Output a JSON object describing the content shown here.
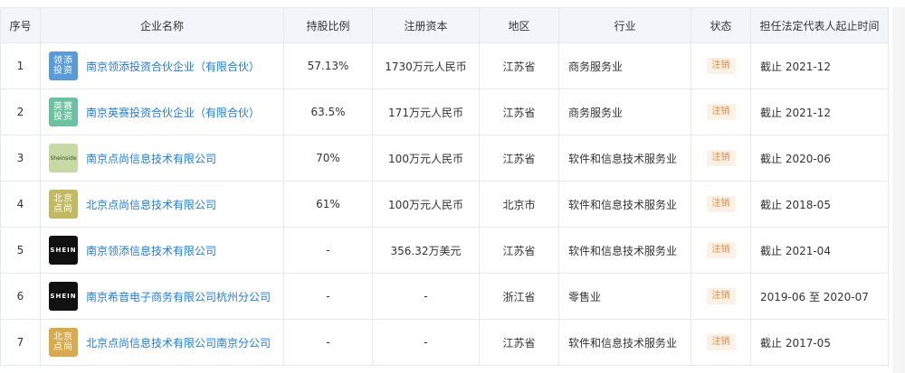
{
  "headers": {
    "index": "序号",
    "company": "企业名称",
    "ratio": "持股比例",
    "capital": "注册资本",
    "region": "地区",
    "industry": "行业",
    "status": "状态",
    "tenure": "担任法定代表人起止时间"
  },
  "rows": [
    {
      "index": "1",
      "logo_text": "领添投资",
      "logo_color": "#5b9bd5",
      "logo_style": "light",
      "company": "南京领添投资合伙企业（有限合伙）",
      "ratio": "57.13%",
      "capital": "1730万元人民币",
      "region": "江苏省",
      "industry": "商务服务业",
      "status": "注销",
      "tenure": "截止 2021-12"
    },
    {
      "index": "2",
      "logo_text": "英赛投资",
      "logo_color": "#6cc1a1",
      "logo_style": "light",
      "company": "南京英赛投资合伙企业（有限合伙）",
      "ratio": "63.5%",
      "capital": "171万元人民币",
      "region": "江苏省",
      "industry": "商务服务业",
      "status": "注销",
      "tenure": "截止 2021-12"
    },
    {
      "index": "3",
      "logo_text": "Sheinside",
      "logo_color": "#c7d9a5",
      "logo_style": "sheinside",
      "company": "南京点尚信息技术有限公司",
      "ratio": "70%",
      "capital": "100万元人民币",
      "region": "江苏省",
      "industry": "软件和信息技术服务业",
      "status": "注销",
      "tenure": "截止 2020-06"
    },
    {
      "index": "4",
      "logo_text": "北京点尚",
      "logo_color": "#c2b963",
      "logo_style": "light",
      "company": "北京点尚信息技术有限公司",
      "ratio": "61%",
      "capital": "100万元人民币",
      "region": "北京市",
      "industry": "软件和信息技术服务业",
      "status": "注销",
      "tenure": "截止 2018-05"
    },
    {
      "index": "5",
      "logo_text": "SHEIN",
      "logo_color": "#111111",
      "logo_style": "dark",
      "company": "南京领添信息技术有限公司",
      "ratio": "-",
      "capital": "356.32万美元",
      "region": "江苏省",
      "industry": "软件和信息技术服务业",
      "status": "注销",
      "tenure": "截止 2021-04"
    },
    {
      "index": "6",
      "logo_text": "SHEIN",
      "logo_color": "#111111",
      "logo_style": "dark",
      "company": "南京希音电子商务有限公司杭州分公司",
      "ratio": "-",
      "capital": "-",
      "region": "浙江省",
      "industry": "零售业",
      "status": "注销",
      "tenure": "2019-06 至 2020-07"
    },
    {
      "index": "7",
      "logo_text": "北京点尚",
      "logo_color": "#d9a94e",
      "logo_style": "light",
      "company": "北京点尚信息技术有限公司南京分公司",
      "ratio": "-",
      "capital": "-",
      "region": "江苏省",
      "industry": "软件和信息技术服务业",
      "status": "注销",
      "tenure": "截止 2017-05"
    }
  ]
}
